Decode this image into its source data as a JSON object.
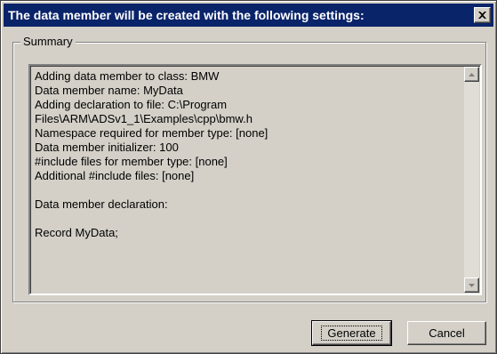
{
  "window": {
    "title": "The data member will be created with the following settings:"
  },
  "summary": {
    "group_label": "Summary",
    "lines": [
      "Adding data member to class: BMW",
      "Data member name: MyData",
      "Adding declaration to file: C:\\Program",
      "Files\\ARM\\ADSv1_1\\Examples\\cpp\\bmw.h",
      "Namespace required for member type: [none]",
      "Data member initializer: 100",
      "#include files for member type: [none]",
      "Additional #include files: [none]",
      "",
      "Data member declaration:",
      "",
      "Record MyData;"
    ]
  },
  "buttons": {
    "generate_label": "Generate",
    "cancel_label": "Cancel"
  },
  "icons": {
    "close": "close-icon",
    "scroll_up": "arrow-up-icon",
    "scroll_down": "arrow-down-icon"
  }
}
